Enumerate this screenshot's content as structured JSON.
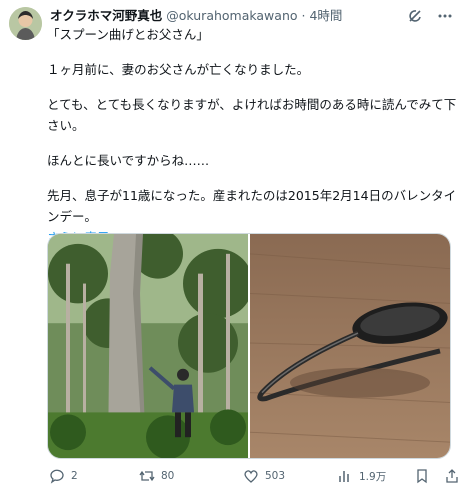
{
  "author": {
    "name": "オクラホマ河野真也",
    "handle": "@okurahomakawano",
    "separator": "·",
    "time": "4時間"
  },
  "tweet_lines": [
    "「スプーン曲げとお父さん」",
    "１ヶ月前に、妻のお父さんが亡くなりました。",
    "とても、とても長くなりますが、よければお時間のある時に読んでみて下さい。",
    "ほんとに長いですからね……",
    "先月、息子が11歳になった。産まれたのは2015年2月14日のバレンタインデー。"
  ],
  "show_more": "さらに表示",
  "actions": {
    "replies": "2",
    "retweets": "80",
    "likes": "503",
    "views": "1.9万"
  },
  "icons": [
    "grok-icon",
    "more-icon",
    "reply-icon",
    "retweet-icon",
    "like-icon",
    "views-icon",
    "bookmark-icon",
    "share-icon"
  ]
}
